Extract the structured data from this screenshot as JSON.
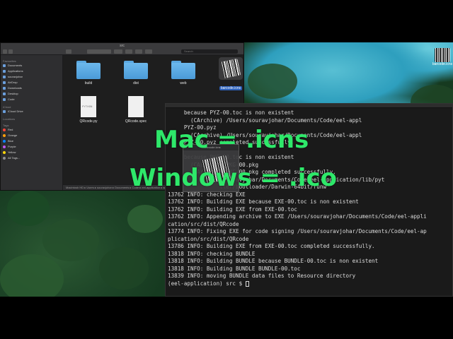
{
  "desktop": {
    "icon_label": "barcode.icns"
  },
  "finder": {
    "window_title": "src",
    "search_placeholder": "Search",
    "sidebar": {
      "favorites_header": "Favourites",
      "favorites": [
        "Documents",
        "Applications",
        "souravjohar",
        "AirDrop",
        "Downloads",
        "Desktop",
        "Code"
      ],
      "icloud_header": "iCloud",
      "icloud": [
        "iCloud Drive"
      ],
      "locations_header": "Locations",
      "tags_header": "Tags",
      "tags": [
        {
          "name": "Red",
          "color": "#ff453a"
        },
        {
          "name": "Orange",
          "color": "#ff9f0a"
        },
        {
          "name": "Blue",
          "color": "#0a84ff"
        },
        {
          "name": "Purple",
          "color": "#bf5af2"
        },
        {
          "name": "Yellow",
          "color": "#ffd60a"
        },
        {
          "name": "All Tags...",
          "color": "#8e8e93"
        }
      ]
    },
    "files": [
      {
        "name": "build",
        "kind": "folder"
      },
      {
        "name": "dist",
        "kind": "folder"
      },
      {
        "name": "web",
        "kind": "folder"
      },
      {
        "name": "barcode.icns",
        "kind": "icns",
        "selected": true
      },
      {
        "name": "QRcode.py",
        "kind": "python"
      },
      {
        "name": "QRcode.spec",
        "kind": "doc"
      }
    ],
    "pathbar": "Macintosh HD ▸ Users ▸ souravjohar ▸ Documents ▸ Code ▸ eel-application ▸ src"
  },
  "drag_preview": {
    "title": "barcode.icns"
  },
  "captions": {
    "mac": "Mac = .icns",
    "windows": "Windows = .ico"
  },
  "terminal": {
    "lines": [
      "     because PYZ-00.toc is non existent",
      "       (CArchive) /Users/souravjohar/Documents/Code/eel-appl",
      "     PYZ-00.pyz",
      "       (CArchive) /Users/souravjohar/Documents/Code/eel-appl",
      "     PYZ-00.pyz completed successfully.",
      "",
      "     because PKG-00.toc is non existent",
      "       (CArchive) PKG-00.pkg",
      "       (CArchive) PKG-00.pkg completed successfully.",
      "                /souravjohar/Documents/Code/eel-application/lib/pyt",
      "                ller/bootloader/Darwin-64bit/runw",
      "13762 INFO: checking EXE",
      "13762 INFO: Building EXE because EXE-00.toc is non existent",
      "13762 INFO: Building EXE from EXE-00.toc",
      "13762 INFO: Appending archive to EXE /Users/souravjohar/Documents/Code/eel-appli",
      "cation/src/dist/QRcode",
      "13774 INFO: Fixing EXE for code signing /Users/souravjohar/Documents/Code/eel-ap",
      "plication/src/dist/QRcode",
      "13786 INFO: Building EXE from EXE-00.toc completed successfully.",
      "13818 INFO: checking BUNDLE",
      "13818 INFO: Building BUNDLE because BUNDLE-00.toc is non existent",
      "13818 INFO: Building BUNDLE BUNDLE-00.toc",
      "13839 INFO: moving BUNDLE data files to Resource directory",
      "(eel-application) src $"
    ]
  }
}
